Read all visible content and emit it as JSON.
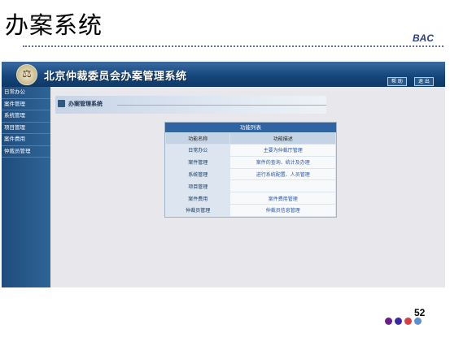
{
  "slide": {
    "title": "办案系统",
    "brand": "BAC",
    "page_number": "52",
    "dot_colors": [
      "#6a1e8a",
      "#3a28a8",
      "#d84040",
      "#5b8fd6"
    ]
  },
  "app": {
    "logo_glyph": "⚖",
    "title": "北京仲裁委员会办案管理系统",
    "header_buttons": [
      "帮  助",
      "退  出"
    ],
    "colors": {
      "banner": "#14457a",
      "sidebar": "#1f4c7c",
      "panel_header": "#2f63a2",
      "link": "#2a58a8"
    }
  },
  "sidebar": {
    "items": [
      {
        "label": "日常办公"
      },
      {
        "label": "案件管理"
      },
      {
        "label": "系统管理"
      },
      {
        "label": "项目管理"
      },
      {
        "label": "案件费用"
      },
      {
        "label": "仲裁员管理"
      }
    ]
  },
  "page": {
    "heading": "办案管理系统"
  },
  "functions": {
    "title": "功能列表",
    "columns": [
      "功能名称",
      "功能描述"
    ],
    "rows": [
      {
        "name": "日常办公",
        "desc": "主要为仲裁厅管理"
      },
      {
        "name": "案件管理",
        "desc": "案件的查询、统计及办理"
      },
      {
        "name": "系统管理",
        "desc": "进行系统配置、人员管理"
      },
      {
        "name": "项目管理",
        "desc": ""
      },
      {
        "name": "案件费用",
        "desc": "案件费用管理"
      },
      {
        "name": "仲裁员管理",
        "desc": "仲裁员信息管理"
      }
    ]
  }
}
